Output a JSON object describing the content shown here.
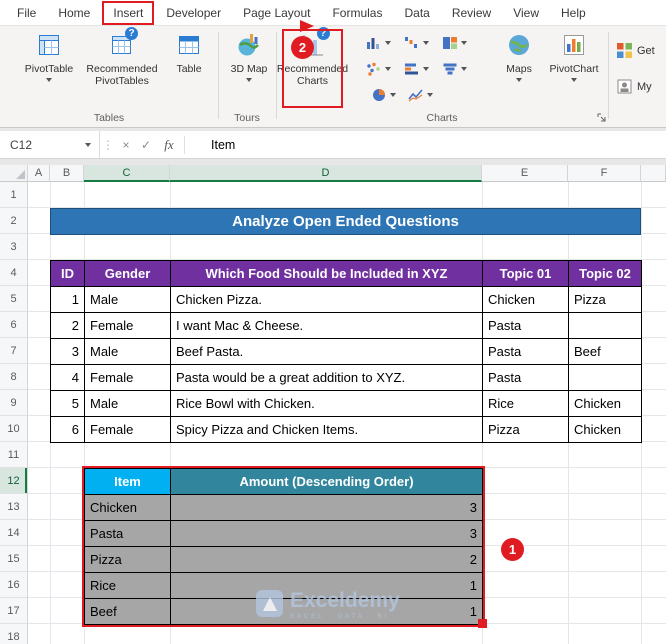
{
  "colors": {
    "annotation_red": "#E11B22",
    "title_banner_blue": "#2E75B6",
    "table1_header_purple": "#7030A0",
    "item_header_cyan": "#00B0F0",
    "amount_header_teal": "#31859C",
    "result_row_gray": "#A6A6A6",
    "selection_green": "#127C43"
  },
  "ribbon": {
    "tabs": [
      "File",
      "Home",
      "Insert",
      "Developer",
      "Page Layout",
      "Formulas",
      "Data",
      "Review",
      "View",
      "Help"
    ],
    "active_tab": "Insert",
    "tables_group": {
      "label": "Tables",
      "pivottable": "PivotTable",
      "recommended_pivottables": "Recommended PivotTables",
      "table": "Table"
    },
    "tours_group": {
      "label": "Tours",
      "map_3d": "3D Map"
    },
    "charts_group": {
      "label": "Charts",
      "recommended_charts": "Recommended Charts",
      "maps": "Maps",
      "pivotchart": "PivotChart"
    },
    "addins": {
      "get": "Get",
      "my": "My"
    }
  },
  "icons": {
    "question": "?"
  },
  "formula_bar": {
    "name_box": "C12",
    "dots": "⋮",
    "cancel": "×",
    "enter": "✓",
    "fx": "fx",
    "content": "Item"
  },
  "sheet": {
    "columns": [
      "A",
      "B",
      "C",
      "D",
      "E",
      "F"
    ],
    "rows": [
      "1",
      "2",
      "3",
      "4",
      "5",
      "6",
      "7",
      "8",
      "9",
      "10",
      "11",
      "12",
      "13",
      "14",
      "15",
      "16",
      "17",
      "18"
    ]
  },
  "title_banner": "Analyze Open Ended Questions",
  "table1": {
    "headers": [
      "ID",
      "Gender",
      "Which Food Should be Included in XYZ",
      "Topic 01",
      "Topic 02"
    ],
    "rows": [
      {
        "id": "1",
        "gender": "Male",
        "food": "Chicken Pizza.",
        "topic1": "Chicken",
        "topic2": "Pizza"
      },
      {
        "id": "2",
        "gender": "Female",
        "food": "I want Mac & Cheese.",
        "topic1": "Pasta",
        "topic2": ""
      },
      {
        "id": "3",
        "gender": "Male",
        "food": "Beef Pasta.",
        "topic1": "Pasta",
        "topic2": "Beef"
      },
      {
        "id": "4",
        "gender": "Female",
        "food": "Pasta would be a great addition to XYZ.",
        "topic1": "Pasta",
        "topic2": ""
      },
      {
        "id": "5",
        "gender": "Male",
        "food": "Rice Bowl with Chicken.",
        "topic1": "Rice",
        "topic2": "Chicken"
      },
      {
        "id": "6",
        "gender": "Female",
        "food": "Spicy Pizza and Chicken Items.",
        "topic1": "Pizza",
        "topic2": "Chicken"
      }
    ]
  },
  "table2": {
    "item_header": "Item",
    "amount_header": "Amount (Descending Order)",
    "rows": [
      {
        "item": "Chicken",
        "amount": "3"
      },
      {
        "item": "Pasta",
        "amount": "3"
      },
      {
        "item": "Pizza",
        "amount": "2"
      },
      {
        "item": "Rice",
        "amount": "1"
      },
      {
        "item": "Beef",
        "amount": "1"
      }
    ]
  },
  "annotations": {
    "step1": "1",
    "step2": "2"
  },
  "watermark": {
    "name": "Exceldemy",
    "tagline": "EXCEL · DATA · BI"
  }
}
